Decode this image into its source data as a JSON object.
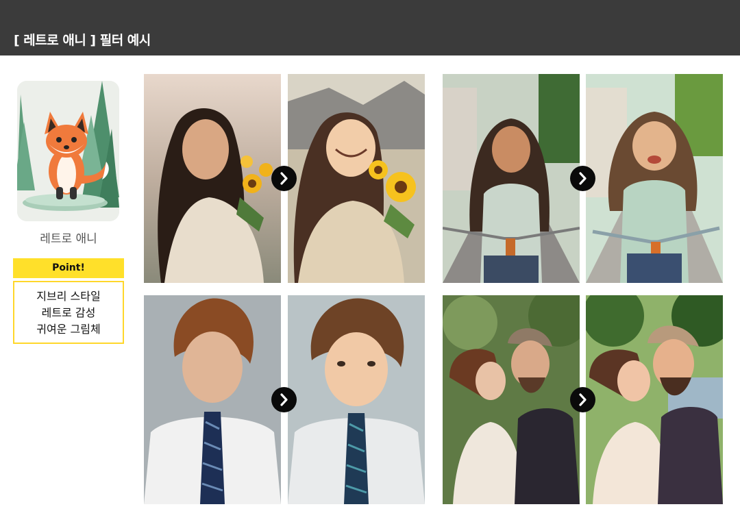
{
  "header": {
    "title": "[ 레트로 애니 ] 필터 예시"
  },
  "sidebar": {
    "thumbnail_icon": "fox-illustration",
    "filter_name": "레트로 애니",
    "point_label": "Point!",
    "point_lines": [
      "지브리 스타일",
      "레트로 감성",
      "귀여운 그림체"
    ]
  },
  "colors": {
    "header_bg": "#3b3b3b",
    "accent_yellow": "#ffe02a",
    "arrow_bg": "#0a0a0a"
  },
  "examples": [
    {
      "name": "girl-with-sunflowers",
      "before": "photo",
      "after": "retro-anime"
    },
    {
      "name": "girl-on-bicycle",
      "before": "photo",
      "after": "retro-anime"
    },
    {
      "name": "young-man-in-tie",
      "before": "photo",
      "after": "retro-anime"
    },
    {
      "name": "wedding-couple",
      "before": "photo",
      "after": "retro-anime"
    }
  ],
  "icons": {
    "next": "chevron-right-icon"
  }
}
